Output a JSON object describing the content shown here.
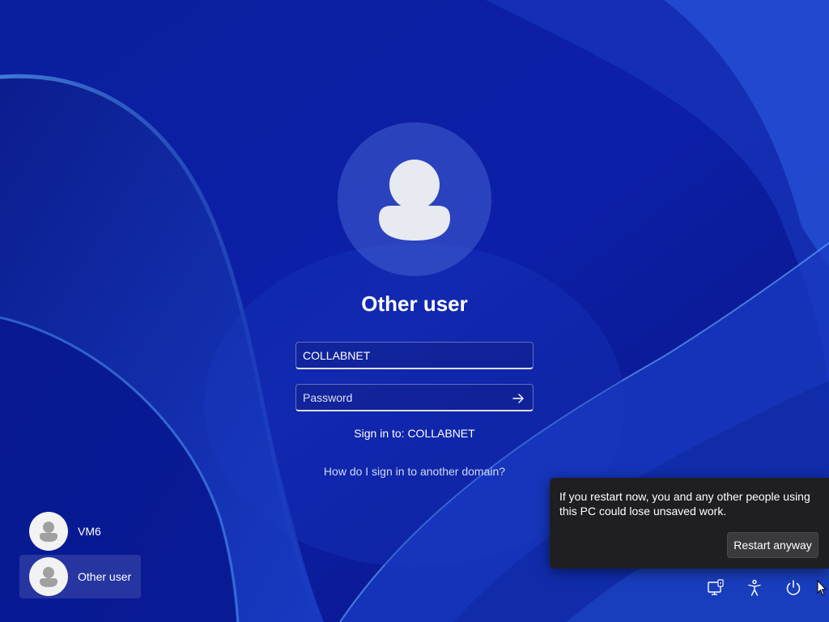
{
  "login": {
    "user_name": "Other user",
    "username_value": "COLLABNET",
    "password_placeholder": "Password",
    "sign_in_to": "Sign in to: COLLABNET",
    "other_domain_link": "How do I sign in to another domain?"
  },
  "user_list": [
    {
      "label": "VM6",
      "selected": false
    },
    {
      "label": "Other user",
      "selected": true
    }
  ],
  "restart_popup": {
    "message": "If you restart now, you and any other people using this PC could lose unsaved work.",
    "button_label": "Restart anyway"
  },
  "tray_icons": [
    "network-icon",
    "accessibility-icon",
    "power-icon"
  ],
  "colors": {
    "wallpaper_base": "#0a1a9a",
    "wallpaper_light": "#3a6ee0",
    "popup_bg": "#1f1f22",
    "button_bg": "#3a3a3d"
  }
}
